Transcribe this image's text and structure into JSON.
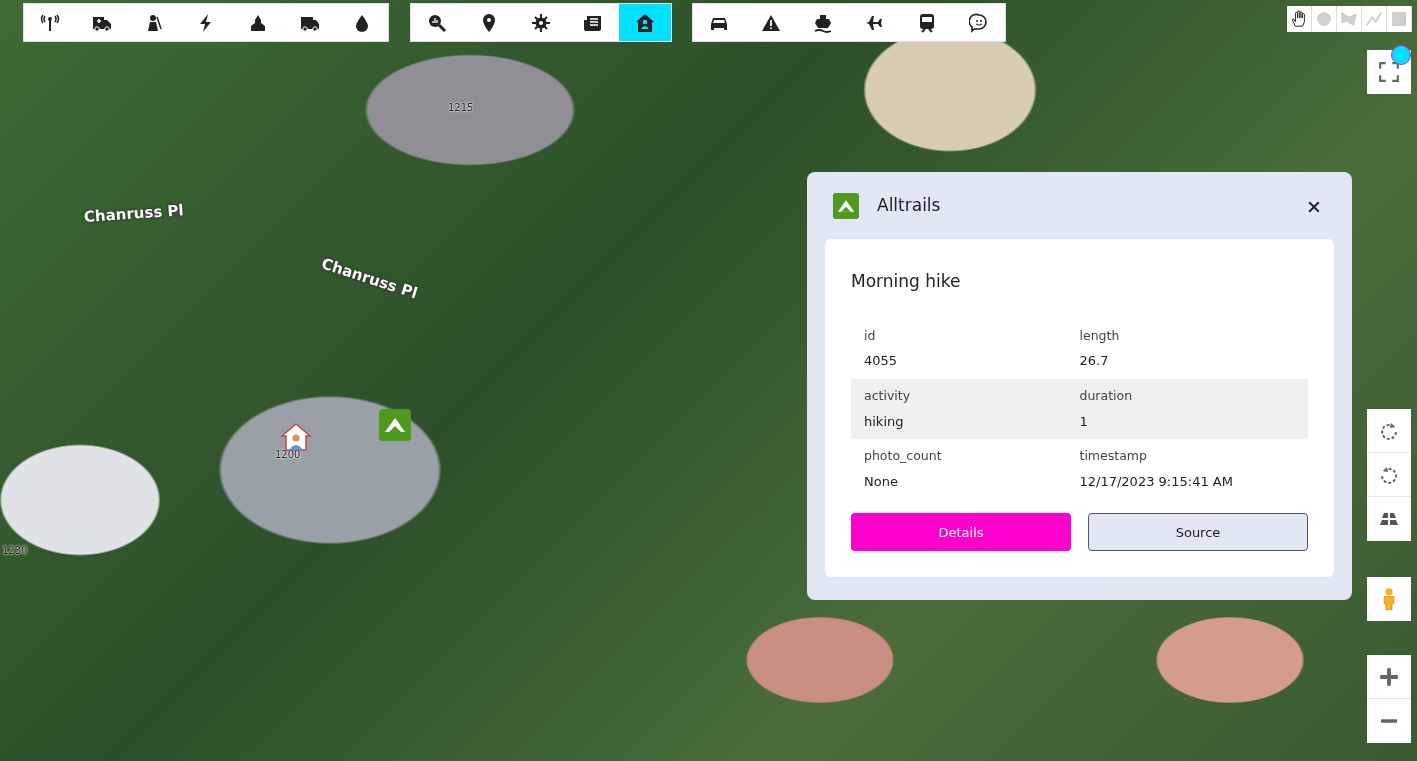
{
  "map": {
    "labels": [
      {
        "text": "Chanruss Pl",
        "kind": "street"
      },
      {
        "text": "Chanruss Pl",
        "kind": "street"
      },
      {
        "text": "1215",
        "kind": "number"
      },
      {
        "text": "1200",
        "kind": "number"
      },
      {
        "text": "1230",
        "kind": "number"
      }
    ]
  },
  "toolbar_groups": [
    {
      "items": [
        {
          "selected": false
        },
        {
          "selected": false
        },
        {
          "selected": false
        },
        {
          "selected": false
        },
        {
          "selected": false
        },
        {
          "selected": false
        },
        {
          "selected": false
        }
      ]
    },
    {
      "items": [
        {
          "selected": false
        },
        {
          "selected": false
        },
        {
          "selected": false
        },
        {
          "selected": false
        },
        {
          "selected": true
        }
      ]
    },
    {
      "items": [
        {
          "selected": false
        },
        {
          "selected": false
        },
        {
          "selected": false
        },
        {
          "selected": false
        },
        {
          "selected": false
        },
        {
          "selected": false
        }
      ]
    }
  ],
  "draw_tools": [
    {
      "selected": true
    },
    {
      "selected": false
    },
    {
      "selected": false
    },
    {
      "selected": false
    },
    {
      "selected": false
    }
  ],
  "popup": {
    "title": "Alltrails",
    "card_title": "Morning hike",
    "fields": [
      {
        "label": "id",
        "value": "4055"
      },
      {
        "label": "length",
        "value": "26.7"
      },
      {
        "label": "activity",
        "value": "hiking"
      },
      {
        "label": "duration",
        "value": "1"
      },
      {
        "label": "photo_count",
        "value": "None"
      },
      {
        "label": "timestamp",
        "value": "12/17/2023 9:15:41 AM"
      }
    ],
    "buttons": [
      {
        "label": "Details",
        "kind": "primary"
      },
      {
        "label": "Source",
        "kind": "secondary"
      }
    ]
  }
}
